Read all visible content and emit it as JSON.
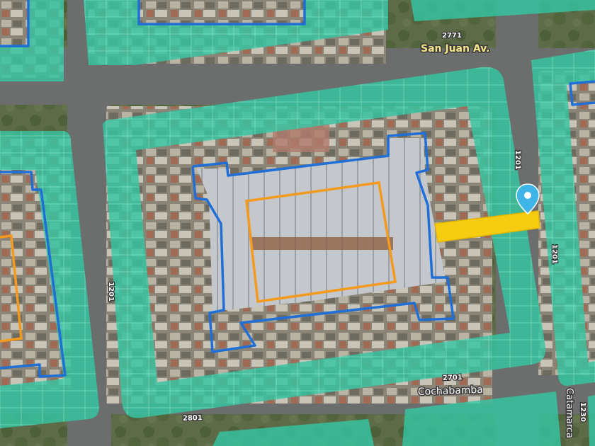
{
  "map": {
    "streets": {
      "san_juan": "San Juan Av.",
      "cochabamba": "Cochabamba",
      "catamarca": "Catamarca"
    },
    "house_numbers": {
      "top": "2771",
      "right_upper": "1201",
      "right_lower": "1201",
      "left": "1201",
      "bottom_left": "2801",
      "bottom_center": "2701",
      "bottom_right": "1230"
    },
    "colors": {
      "parcel_fill": "#34c6a2",
      "parcel_stroke": "#a8f0dc",
      "block_outline": "#1f6fd6",
      "building_outline": "#f39a1f",
      "highlight_lot": "#f5cc10",
      "marker": "#3fb4e6"
    },
    "icons": {
      "marker": "map-pin-icon"
    }
  }
}
